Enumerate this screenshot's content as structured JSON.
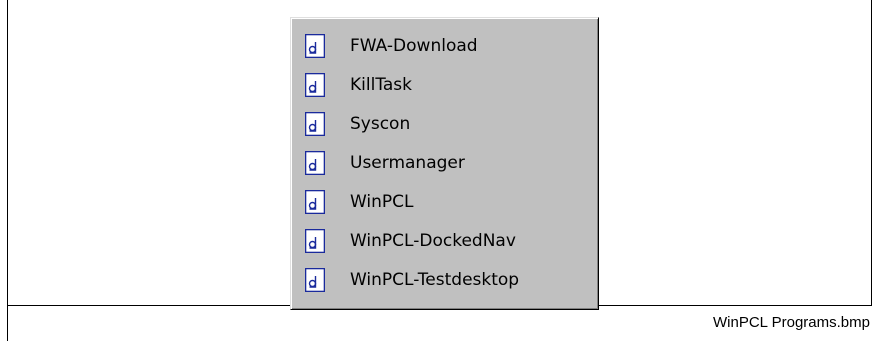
{
  "menu": {
    "items": [
      {
        "label": "FWA-Download",
        "icon": "program-document-icon"
      },
      {
        "label": "KillTask",
        "icon": "program-document-icon"
      },
      {
        "label": "Syscon",
        "icon": "program-document-icon"
      },
      {
        "label": "Usermanager",
        "icon": "program-document-icon"
      },
      {
        "label": "WinPCL",
        "icon": "program-document-icon"
      },
      {
        "label": "WinPCL-DockedNav",
        "icon": "program-document-icon"
      },
      {
        "label": "WinPCL-Testdesktop",
        "icon": "program-document-icon"
      }
    ]
  },
  "caption": "WinPCL Programs.bmp",
  "colors": {
    "menu_background": "#c0c0c0",
    "icon_stroke": "#1a2a9c"
  }
}
